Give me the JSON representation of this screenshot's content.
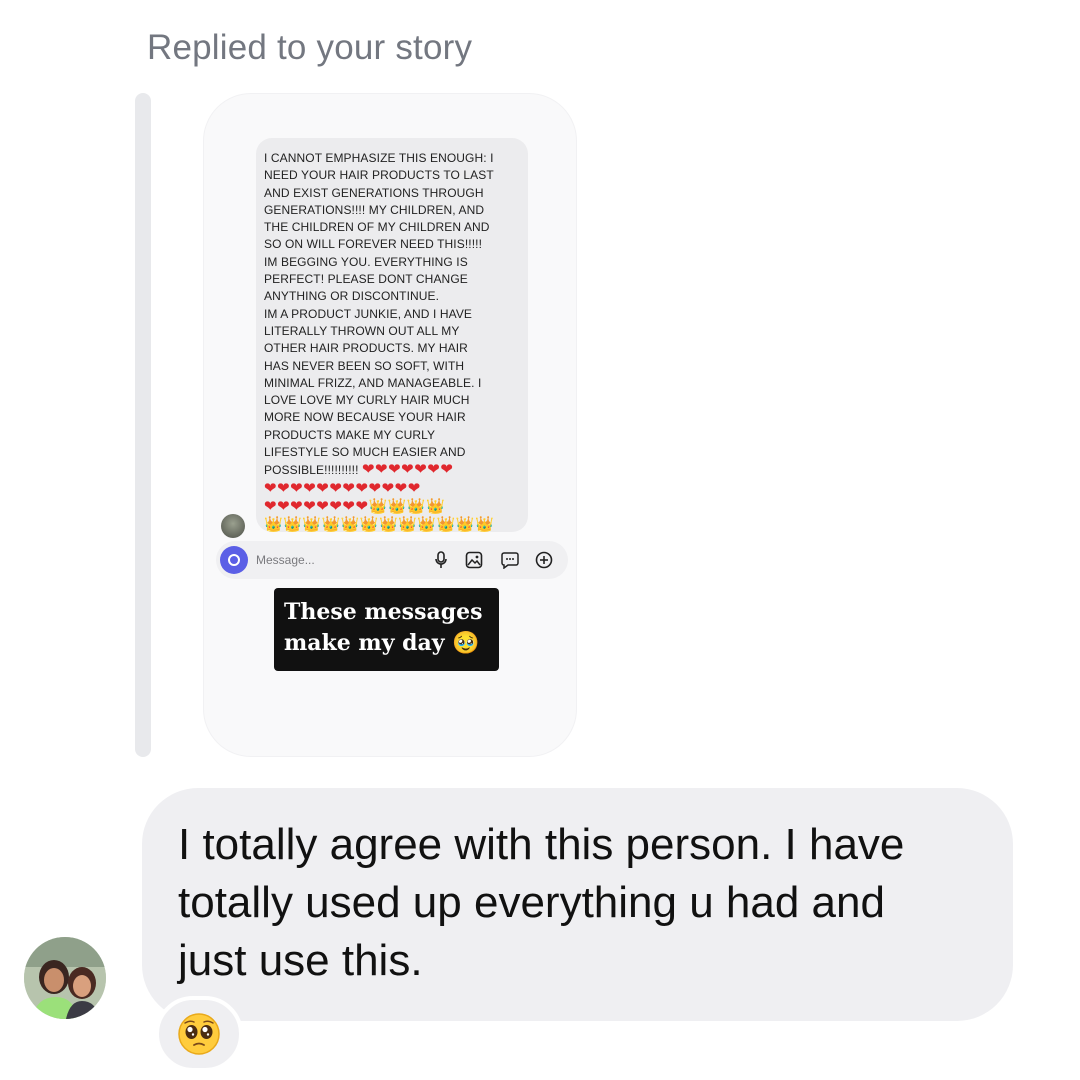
{
  "header": {
    "replied_label": "Replied to your story"
  },
  "story": {
    "quoted_message": "I CANNOT EMPHASIZE THIS ENOUGH: I\nNEED YOUR HAIR PRODUCTS TO LAST\nAND EXIST GENERATIONS THROUGH\nGENERATIONS!!!! MY CHILDREN, AND\nTHE CHILDREN OF MY CHILDREN AND\nSO ON WILL FOREVER NEED THIS!!!!!\nIM BEGGING YOU. EVERYTHING IS\nPERFECT! PLEASE DONT CHANGE\nANYTHING OR DISCONTINUE.\nIM A PRODUCT JUNKIE, AND I HAVE\nLITERALLY THROWN OUT ALL MY\nOTHER HAIR PRODUCTS. MY HAIR\nHAS NEVER BEEN SO SOFT, WITH\nMINIMAL FRIZZ, AND MANAGEABLE. I\nLOVE LOVE MY CURLY HAIR MUCH\nMORE NOW BECAUSE YOUR HAIR\nPRODUCTS MAKE MY CURLY\nLIFESTYLE SO MUCH EASIER AND",
    "last_line_text": "POSSIBLE!!!!!!!!!! ",
    "last_line_hearts": "❤❤❤❤❤❤❤",
    "hearts_row": "❤❤❤❤❤❤❤❤❤❤❤❤",
    "mixed_row_hearts": "❤❤❤❤❤❤❤❤",
    "mixed_row_crowns": "👑👑👑👑",
    "crowns_row": "👑👑👑👑👑👑👑👑👑👑👑👑",
    "composer_placeholder": "Message...",
    "caption_line1": "These messages",
    "caption_line2": "make my day 🥹",
    "accent_color": "#5b5fe6"
  },
  "reply": {
    "text": "I totally agree with this person. I have\ntotally used up everything u had and\njust use this.",
    "reaction": "🥹"
  },
  "icons": {
    "camera": "camera-icon",
    "mic": "microphone-icon",
    "gallery": "image-icon",
    "sticker": "sticker-icon",
    "add": "plus-circle-icon"
  }
}
